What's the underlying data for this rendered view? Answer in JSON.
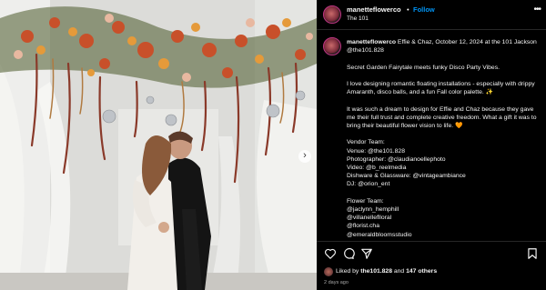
{
  "header": {
    "username": "manetteflowerco",
    "dot": "•",
    "follow_label": "Follow",
    "location": "The 101",
    "more_icon": "more-horizontal-icon"
  },
  "caption": {
    "username": "manetteflowerco",
    "intro": "Effie & Chaz, October 12, 2024 at the 101 Jackson @the101.828",
    "p1": "Secret Garden Fairytale meets funky Disco Party Vibes.",
    "p2": "I love designing romantic floating installations - especially with drippy Amaranth, disco balls, and a fun Fall color palette. ✨",
    "p3": "It was such a dream to design for Effie and Chaz because they gave me their full trust and complete creative freedom. What a gift it was to bring their beautiful flower vision to life. 🧡",
    "vendor_title": "Vendor Team:",
    "vendors": [
      "Venue: @the101.828",
      "Photographer: @claudianoellephoto",
      "Video: @b_reelmedia",
      "Dishware & Glassware: @vintageambiance",
      "DJ: @orion_ent"
    ],
    "flower_title": "Flower Team:",
    "flower_team": [
      "@jaclynn_hemphill",
      "@villanelleflloral",
      "@florist.cha",
      "@emeraldbloomsstudio"
    ]
  },
  "actions": {
    "icons": [
      "heart-icon",
      "comment-icon",
      "share-icon",
      "bookmark-icon"
    ],
    "liked_prefix": "Liked by",
    "liked_user": "the101.828",
    "liked_and": "and",
    "liked_count": "147 others",
    "time_ago": "2 days ago"
  },
  "photo": {
    "next_icon": "chevron-right-icon",
    "next_glyph": "›"
  },
  "colors": {
    "background": "#000000",
    "link": "#0095f6",
    "muted": "#a8a8a8"
  }
}
